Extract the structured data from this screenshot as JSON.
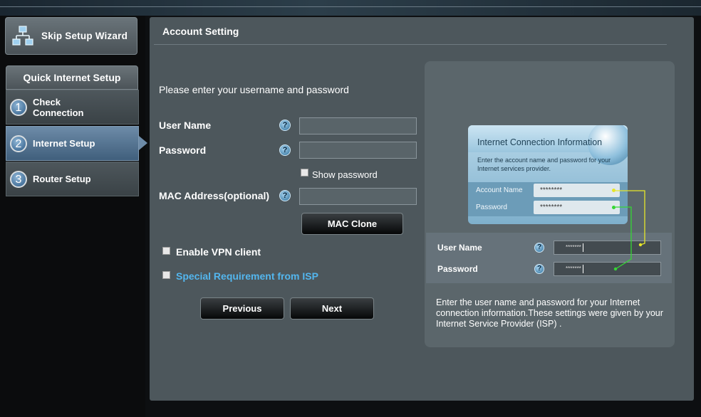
{
  "left_nav": {
    "skip_wizard_label": "Skip Setup Wizard",
    "skip_wizard_icon": "network-icon",
    "quick_setup_title": "Quick Internet Setup",
    "steps": [
      {
        "num": "1",
        "label": "Check Connection",
        "active": false
      },
      {
        "num": "2",
        "label": "Internet Setup",
        "active": true
      },
      {
        "num": "3",
        "label": "Router Setup",
        "active": false
      }
    ]
  },
  "main": {
    "title": "Account Setting",
    "prompt": "Please enter your username and password",
    "fields": {
      "username_label": "User Name",
      "username_value": "",
      "password_label": "Password",
      "password_value": "",
      "show_password_label": "Show password",
      "show_password_checked": false,
      "mac_label": "MAC Address(optional)",
      "mac_value": ""
    },
    "help_glyph": "?",
    "mac_clone_label": "MAC Clone",
    "enable_vpn_label": "Enable VPN client",
    "special_isp_label": "Special Requirement from ISP",
    "previous_label": "Previous",
    "next_label": "Next",
    "accent_link_color": "#53b6ee"
  },
  "info_panel": {
    "card_title": "Internet Connection Information",
    "card_desc": "Enter the account name and password for your Internet services provider.",
    "card_account_label": "Account Name",
    "card_account_value": "********",
    "card_password_label": "Password",
    "card_password_value": "********",
    "strip_user_label": "User Name",
    "strip_user_value": "*******",
    "strip_pass_label": "Password",
    "strip_pass_value": "*******",
    "description": "Enter the user name and password for your Internet connection information.These settings were given by your Internet Service Provider (ISP) .",
    "connector_colors": [
      "#e6e629",
      "#35d635"
    ]
  }
}
